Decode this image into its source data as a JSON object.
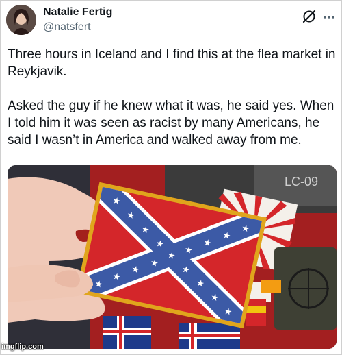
{
  "author": {
    "display_name": "Natalie Fertig",
    "handle": "@natsfert"
  },
  "tweet": {
    "text": "Three hours in Iceland and I find this at the flea market in Reykjavik.\n\nAsked the guy if he knew what it was, he said yes. When I told him it was seen as racist by many Americans, he said I wasn’t in America and walked away from me."
  },
  "icons": {
    "grok": "grok-icon",
    "more": "more-icon"
  },
  "media": {
    "description_icon": "photo",
    "patch_label_text": "LC-09"
  },
  "watermark": {
    "text": "imgflip.com"
  },
  "colors": {
    "flag_red": "#d4262a",
    "flag_blue": "#3c5aa6",
    "flag_border": "#e0a51c"
  }
}
